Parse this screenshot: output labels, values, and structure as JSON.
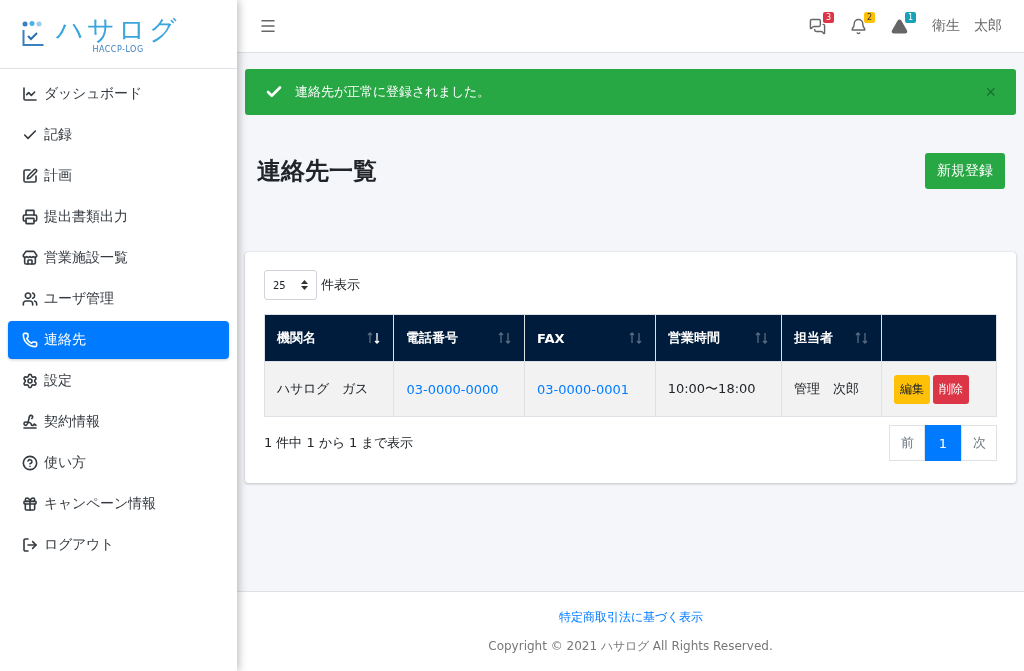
{
  "brand": {
    "name": "ハサログ",
    "sub": "HACCP-LOG"
  },
  "sidebar": {
    "items": [
      {
        "label": "ダッシュボード",
        "selected": false
      },
      {
        "label": "記録",
        "selected": false
      },
      {
        "label": "計画",
        "selected": false
      },
      {
        "label": "提出書類出力",
        "selected": false
      },
      {
        "label": "営業施設一覧",
        "selected": false
      },
      {
        "label": "ユーザ管理",
        "selected": false
      },
      {
        "label": "連絡先",
        "selected": true
      },
      {
        "label": "設定",
        "selected": false
      },
      {
        "label": "契約情報",
        "selected": false
      },
      {
        "label": "使い方",
        "selected": false
      },
      {
        "label": "キャンペーン情報",
        "selected": false
      },
      {
        "label": "ログアウト",
        "selected": false
      }
    ]
  },
  "header": {
    "notifications": [
      {
        "kind": "messages",
        "count": "3",
        "color": "#dc3545"
      },
      {
        "kind": "bell",
        "count": "2",
        "color": "#ffc107"
      },
      {
        "kind": "warning",
        "count": "1",
        "color": "#17a2b8"
      }
    ],
    "user": "衛生　太郎"
  },
  "alert": {
    "message": "連絡先が正常に登録されました。",
    "close": "×"
  },
  "page": {
    "title": "連絡先一覧",
    "new_button": "新規登録"
  },
  "table": {
    "page_size": "25",
    "page_size_label": "件表示",
    "columns": [
      {
        "label": "機関名",
        "sorted": true
      },
      {
        "label": "電話番号",
        "sorted": false
      },
      {
        "label": "FAX",
        "sorted": false
      },
      {
        "label": "営業時間",
        "sorted": false
      },
      {
        "label": "担当者",
        "sorted": false
      }
    ],
    "rows": [
      {
        "cells": [
          {
            "kind": "text",
            "value": "ハサログ　ガス"
          },
          {
            "kind": "link",
            "value": "03-0000-0000"
          },
          {
            "kind": "link",
            "value": "03-0000-0001"
          },
          {
            "kind": "text",
            "value": "10:00〜18:00"
          },
          {
            "kind": "text",
            "value": "管理　次郎"
          }
        ],
        "edit": "編集",
        "delete": "削除"
      }
    ],
    "info": "1 件中 1 から 1 まで表示",
    "pagination": [
      {
        "label": "前",
        "selected": false
      },
      {
        "label": "1",
        "selected": true
      },
      {
        "label": "次",
        "selected": false
      }
    ]
  },
  "footer": {
    "link": "特定商取引法に基づく表示",
    "copyright": "Copyright © 2021 ハサログ All Rights Reserved."
  }
}
